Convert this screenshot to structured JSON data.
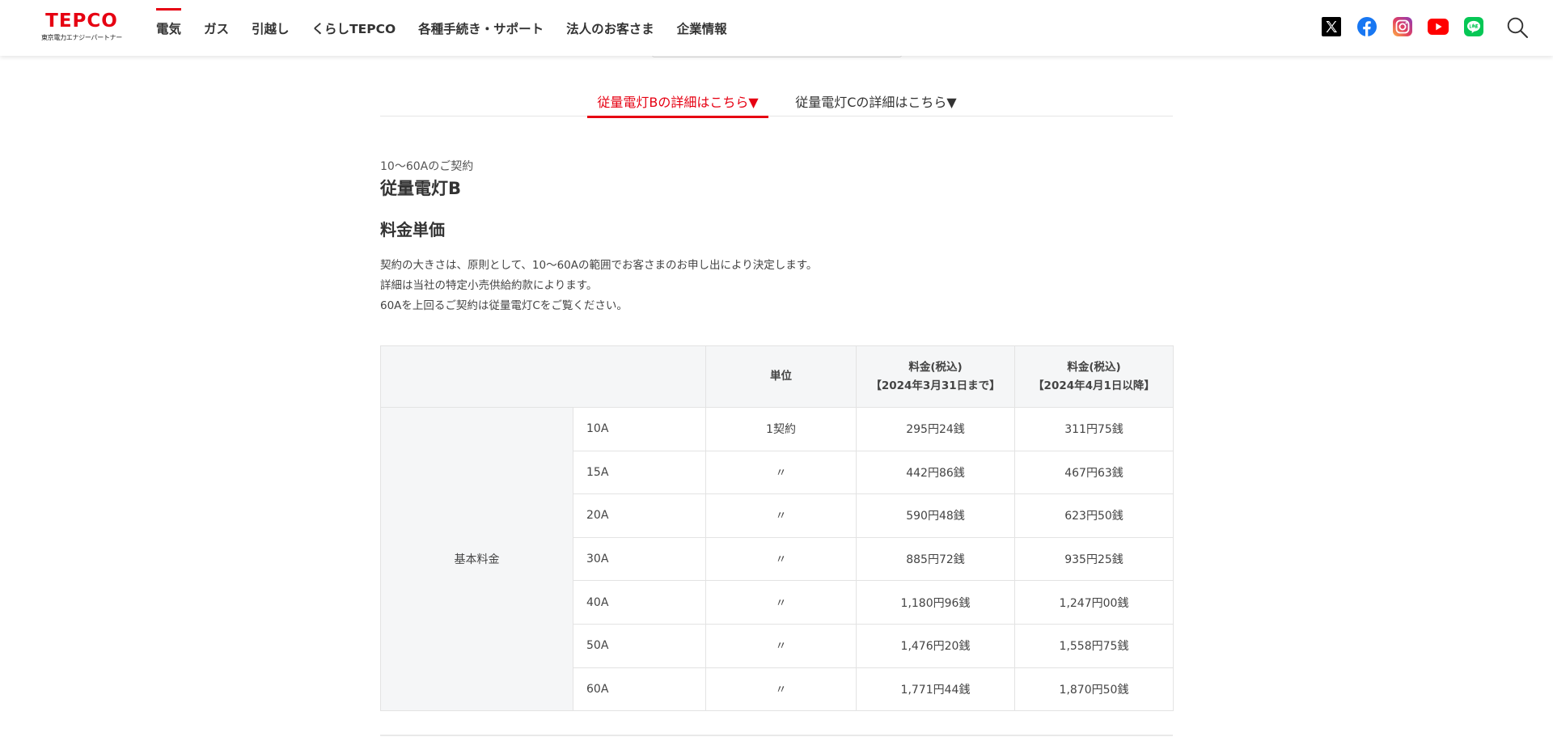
{
  "header": {
    "logo": {
      "main": "TEPCO",
      "sub": "東京電力エナジーパートナー"
    },
    "nav": [
      {
        "label": "電気",
        "active": true
      },
      {
        "label": "ガス",
        "active": false
      },
      {
        "label": "引越し",
        "active": false
      },
      {
        "label": "くらしTEPCO",
        "active": false
      },
      {
        "label": "各種手続き・サポート",
        "active": false
      },
      {
        "label": "法人のお客さま",
        "active": false
      },
      {
        "label": "企業情報",
        "active": false
      }
    ],
    "social_icons": [
      "x-icon",
      "facebook-icon",
      "instagram-icon",
      "youtube-icon",
      "line-icon"
    ],
    "search_icon": "search-icon"
  },
  "tabs": [
    {
      "label": "従量電灯Bの詳細はこちら▼",
      "active": true
    },
    {
      "label": "従量電灯Cの詳細はこちら▼",
      "active": false
    }
  ],
  "content": {
    "eyebrow": "10～60Aのご契約",
    "plan_title": "従量電灯B",
    "section_title": "料金単価",
    "description": [
      "契約の大きさは、原則として、10～60Aの範囲でお客さまのお申し出により決定します。",
      "詳細は当社の特定小売供給約款によります。",
      "60Aを上回るご契約は従量電灯Cをご覧ください。"
    ]
  },
  "table": {
    "headers": {
      "item": "",
      "unit": "単位",
      "price_before": {
        "line1": "料金(税込)",
        "line2": "【2024年3月31日まで】"
      },
      "price_after": {
        "line1": "料金(税込)",
        "line2": "【2024年4月1日以降】"
      }
    },
    "item_label": "基本料金",
    "rows": [
      {
        "contract": "10A",
        "unit": "1契約",
        "before": "295円24銭",
        "after": "311円75銭"
      },
      {
        "contract": "15A",
        "unit": "〃",
        "before": "442円86銭",
        "after": "467円63銭"
      },
      {
        "contract": "20A",
        "unit": "〃",
        "before": "590円48銭",
        "after": "623円50銭"
      },
      {
        "contract": "30A",
        "unit": "〃",
        "before": "885円72銭",
        "after": "935円25銭"
      },
      {
        "contract": "40A",
        "unit": "〃",
        "before": "1,180円96銭",
        "after": "1,247円00銭"
      },
      {
        "contract": "50A",
        "unit": "〃",
        "before": "1,476円20銭",
        "after": "1,558円75銭"
      },
      {
        "contract": "60A",
        "unit": "〃",
        "before": "1,771円44銭",
        "after": "1,870円50銭"
      }
    ]
  },
  "colors": {
    "brand_red": "#e60012",
    "text": "#333333",
    "table_header_bg": "#f5f6f7",
    "border": "#e3e3e3"
  }
}
